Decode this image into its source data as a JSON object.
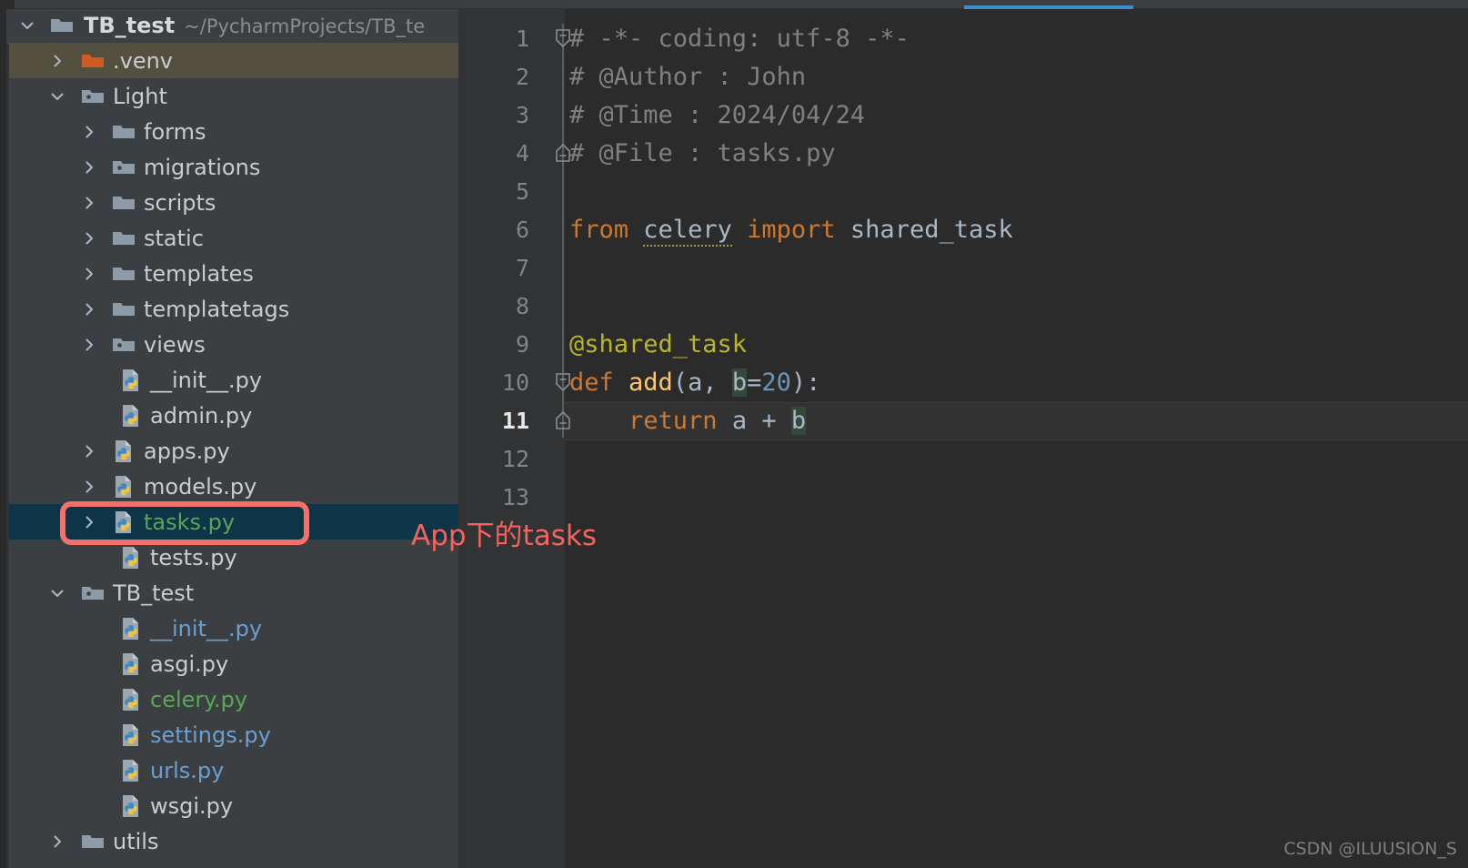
{
  "window": {
    "theme_accent": "#3c8ec6",
    "sidebar_bg": "#3c3f41",
    "editor_bg": "#2b2b2b"
  },
  "project_tree": {
    "root": {
      "name": "TB_test",
      "path": "~/PycharmProjects/TB_te",
      "icon": "folder-icon",
      "expanded": true
    },
    "items": [
      {
        "label": ".venv",
        "icon": "folder-excluded-icon",
        "indent": 1,
        "arrow": "collapsed",
        "color": "white",
        "row_state": "excluded"
      },
      {
        "label": "Light",
        "icon": "folder-module-icon",
        "indent": 1,
        "arrow": "expanded",
        "color": "white",
        "row_state": "normal"
      },
      {
        "label": "forms",
        "icon": "folder-icon",
        "indent": 2,
        "arrow": "collapsed",
        "color": "white",
        "row_state": "normal"
      },
      {
        "label": "migrations",
        "icon": "folder-module-icon",
        "indent": 2,
        "arrow": "collapsed",
        "color": "white",
        "row_state": "normal"
      },
      {
        "label": "scripts",
        "icon": "folder-icon",
        "indent": 2,
        "arrow": "collapsed",
        "color": "white",
        "row_state": "normal"
      },
      {
        "label": "static",
        "icon": "folder-icon",
        "indent": 2,
        "arrow": "collapsed",
        "color": "white",
        "row_state": "normal"
      },
      {
        "label": "templates",
        "icon": "folder-icon",
        "indent": 2,
        "arrow": "collapsed",
        "color": "white",
        "row_state": "normal"
      },
      {
        "label": "templatetags",
        "icon": "folder-icon",
        "indent": 2,
        "arrow": "collapsed",
        "color": "white",
        "row_state": "normal"
      },
      {
        "label": "views",
        "icon": "folder-module-icon",
        "indent": 2,
        "arrow": "collapsed",
        "color": "white",
        "row_state": "normal"
      },
      {
        "label": "__init__.py",
        "icon": "python-file-icon",
        "indent": 3,
        "arrow": "none",
        "color": "white",
        "row_state": "normal"
      },
      {
        "label": "admin.py",
        "icon": "python-file-icon",
        "indent": 3,
        "arrow": "none",
        "color": "white",
        "row_state": "normal"
      },
      {
        "label": "apps.py",
        "icon": "python-file-icon",
        "indent": 2,
        "arrow": "collapsed",
        "color": "white",
        "row_state": "normal"
      },
      {
        "label": "models.py",
        "icon": "python-file-icon",
        "indent": 2,
        "arrow": "collapsed",
        "color": "white",
        "row_state": "normal"
      },
      {
        "label": "tasks.py",
        "icon": "python-file-icon",
        "indent": 2,
        "arrow": "collapsed",
        "color": "green",
        "row_state": "selected"
      },
      {
        "label": "tests.py",
        "icon": "python-file-icon",
        "indent": 3,
        "arrow": "none",
        "color": "white",
        "row_state": "normal"
      },
      {
        "label": "TB_test",
        "icon": "folder-module-icon",
        "indent": 1,
        "arrow": "expanded",
        "color": "white",
        "row_state": "normal"
      },
      {
        "label": "__init__.py",
        "icon": "python-file-icon",
        "indent": 3,
        "arrow": "none",
        "color": "blue",
        "row_state": "normal"
      },
      {
        "label": "asgi.py",
        "icon": "python-file-icon",
        "indent": 3,
        "arrow": "none",
        "color": "white",
        "row_state": "normal"
      },
      {
        "label": "celery.py",
        "icon": "python-file-icon",
        "indent": 3,
        "arrow": "none",
        "color": "green",
        "row_state": "normal"
      },
      {
        "label": "settings.py",
        "icon": "python-file-icon",
        "indent": 3,
        "arrow": "none",
        "color": "blue",
        "row_state": "normal"
      },
      {
        "label": "urls.py",
        "icon": "python-file-icon",
        "indent": 3,
        "arrow": "none",
        "color": "blue",
        "row_state": "normal"
      },
      {
        "label": "wsgi.py",
        "icon": "python-file-icon",
        "indent": 3,
        "arrow": "none",
        "color": "white",
        "row_state": "normal"
      },
      {
        "label": "utils",
        "icon": "folder-icon",
        "indent": 1,
        "arrow": "collapsed",
        "color": "white",
        "row_state": "normal"
      }
    ]
  },
  "annotation": {
    "text": "App下的tasks",
    "color": "#f4635c",
    "box_color": "#f4706a",
    "targets": "tasks.py"
  },
  "editor": {
    "current_line": 11,
    "lines": [
      {
        "num": 1,
        "fold": "start",
        "tokens": [
          {
            "t": "# -*- coding: utf-8 -*-",
            "c": "comment"
          }
        ]
      },
      {
        "num": 2,
        "fold": "none",
        "tokens": [
          {
            "t": "# @Author : John",
            "c": "comment"
          }
        ]
      },
      {
        "num": 3,
        "fold": "none",
        "tokens": [
          {
            "t": "# @Time : 2024/04/24",
            "c": "comment"
          }
        ]
      },
      {
        "num": 4,
        "fold": "end",
        "tokens": [
          {
            "t": "# @File : tasks.py",
            "c": "comment"
          }
        ]
      },
      {
        "num": 5,
        "fold": "none",
        "tokens": []
      },
      {
        "num": 6,
        "fold": "none",
        "tokens": [
          {
            "t": "from",
            "c": "kw"
          },
          {
            "t": " ",
            "c": "plain"
          },
          {
            "t": "celery",
            "c": "id",
            "squiggly": true
          },
          {
            "t": " ",
            "c": "plain"
          },
          {
            "t": "import",
            "c": "kw"
          },
          {
            "t": " ",
            "c": "plain"
          },
          {
            "t": "shared_task",
            "c": "id"
          }
        ]
      },
      {
        "num": 7,
        "fold": "none",
        "tokens": []
      },
      {
        "num": 8,
        "fold": "none",
        "tokens": []
      },
      {
        "num": 9,
        "fold": "none",
        "tokens": [
          {
            "t": "@shared_task",
            "c": "deco"
          }
        ]
      },
      {
        "num": 10,
        "fold": "start",
        "tokens": [
          {
            "t": "def",
            "c": "kw"
          },
          {
            "t": " ",
            "c": "plain"
          },
          {
            "t": "add",
            "c": "func"
          },
          {
            "t": "(",
            "c": "plain"
          },
          {
            "t": "a",
            "c": "id"
          },
          {
            "t": ", ",
            "c": "plain"
          },
          {
            "t": "b",
            "c": "id",
            "highlight": true
          },
          {
            "t": "=",
            "c": "plain"
          },
          {
            "t": "20",
            "c": "num"
          },
          {
            "t": "):",
            "c": "plain"
          }
        ]
      },
      {
        "num": 11,
        "fold": "end",
        "tokens": [
          {
            "t": "    ",
            "c": "plain"
          },
          {
            "t": "return",
            "c": "kw"
          },
          {
            "t": " ",
            "c": "plain"
          },
          {
            "t": "a",
            "c": "id"
          },
          {
            "t": " + ",
            "c": "plain"
          },
          {
            "t": "b",
            "c": "id",
            "highlight": true
          }
        ]
      },
      {
        "num": 12,
        "fold": "none",
        "tokens": []
      },
      {
        "num": 13,
        "fold": "none",
        "tokens": []
      }
    ]
  },
  "watermark": {
    "text": "CSDN @ILUUSION_S"
  }
}
